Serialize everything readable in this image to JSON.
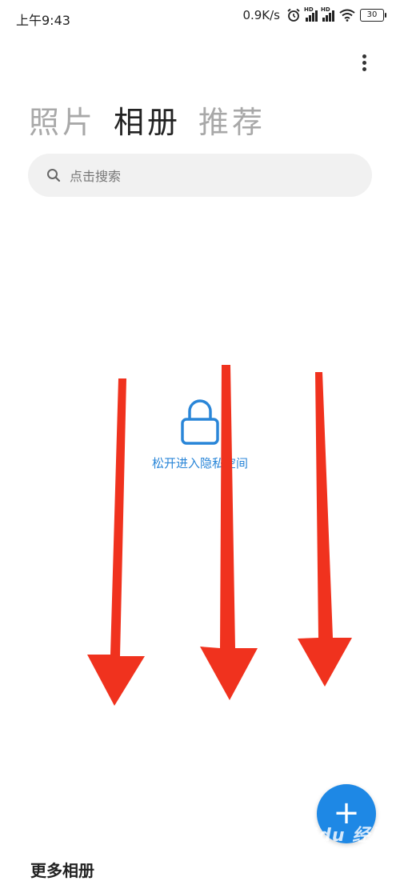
{
  "status_bar": {
    "time": "上午9:43",
    "network_speed": "0.9K/s",
    "battery": "30",
    "icons": [
      "alarm-icon",
      "signal-hd-icon",
      "signal-hd-icon",
      "wifi-icon",
      "battery-icon"
    ]
  },
  "tabs": [
    {
      "label": "照片",
      "active": false
    },
    {
      "label": "相册",
      "active": true
    },
    {
      "label": "推荐",
      "active": false
    }
  ],
  "search": {
    "placeholder": "点击搜索"
  },
  "private_space": {
    "label": "松开进入隐私空间"
  },
  "fab": {
    "label": "+"
  },
  "section": {
    "title": "更多相册"
  },
  "watermark": {
    "text": "Baidu 经验"
  },
  "colors": {
    "accent": "#2a86d8",
    "fab": "#1e88e5",
    "arrow": "#f0321e",
    "search_bg": "#f1f1f1"
  }
}
